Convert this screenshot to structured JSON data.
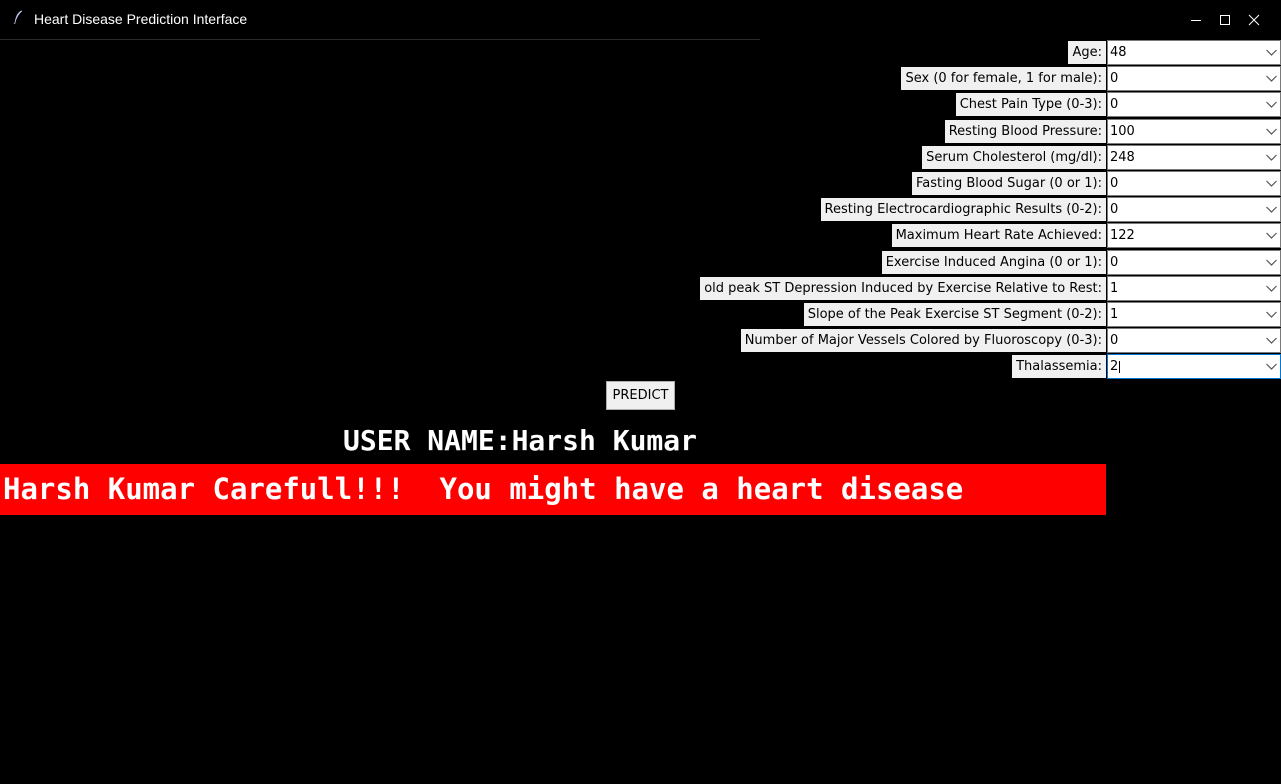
{
  "window": {
    "title": "Heart Disease Prediction Interface",
    "controls": {
      "minimize_icon": "minimize-icon",
      "maximize_icon": "maximize-icon",
      "close_icon": "close-icon"
    }
  },
  "form": {
    "fields": [
      {
        "label": "Age:",
        "value": "48"
      },
      {
        "label": "Sex (0 for female, 1 for male):",
        "value": "0"
      },
      {
        "label": "Chest Pain Type (0-3):",
        "value": "0"
      },
      {
        "label": "Resting Blood Pressure:",
        "value": "100"
      },
      {
        "label": "Serum Cholesterol (mg/dl):",
        "value": "248"
      },
      {
        "label": "Fasting Blood Sugar (0 or 1):",
        "value": "0"
      },
      {
        "label": "Resting Electrocardiographic Results (0-2):",
        "value": "0"
      },
      {
        "label": "Maximum Heart Rate Achieved:",
        "value": "122"
      },
      {
        "label": "Exercise Induced Angina (0 or 1):",
        "value": "0"
      },
      {
        "label": "old peak ST Depression Induced by Exercise Relative to Rest:",
        "value": "1"
      },
      {
        "label": "Slope of the Peak Exercise ST Segment (0-2):",
        "value": "1"
      },
      {
        "label": "Number of Major Vessels Colored by Fluoroscopy (0-3):",
        "value": "0"
      },
      {
        "label": "Thalassemia:",
        "value": "2"
      }
    ],
    "predict_label": "PREDICT"
  },
  "output": {
    "user_name": "USER NAME:Harsh Kumar",
    "result": "Harsh Kumar Carefull!!!  You might have a heart disease",
    "result_color": "#ff0000"
  },
  "colors": {
    "background": "#000000",
    "label_bg": "#f0f0f0",
    "focus_border": "#0078d7"
  }
}
